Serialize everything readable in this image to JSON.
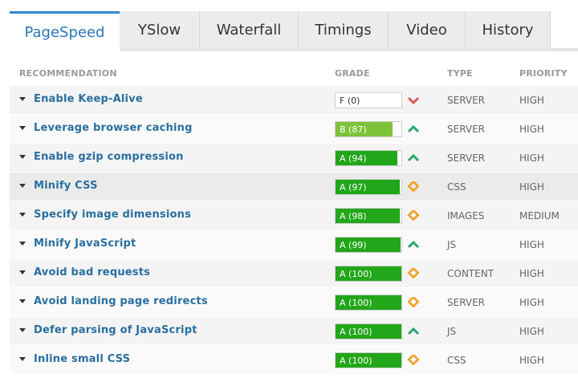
{
  "tabs": [
    {
      "label": "PageSpeed",
      "active": true
    },
    {
      "label": "YSlow",
      "active": false
    },
    {
      "label": "Waterfall",
      "active": false
    },
    {
      "label": "Timings",
      "active": false
    },
    {
      "label": "Video",
      "active": false
    },
    {
      "label": "History",
      "active": false
    }
  ],
  "columns": {
    "recommendation": "RECOMMENDATION",
    "grade": "GRADE",
    "type": "TYPE",
    "priority": "PRIORITY"
  },
  "colors": {
    "grade_a": "#22a61a",
    "grade_b": "#7ec23a",
    "trend_down": "#e05a5a",
    "trend_up": "#2aa86a",
    "trend_neutral": "#f0a020",
    "link": "#2a6f9f"
  },
  "rows": [
    {
      "name": "Enable Keep-Alive",
      "grade": "F (0)",
      "score": 0,
      "letter": "F",
      "trend": "down",
      "type": "SERVER",
      "priority": "HIGH"
    },
    {
      "name": "Leverage browser caching",
      "grade": "B (87)",
      "score": 87,
      "letter": "B",
      "trend": "up",
      "type": "SERVER",
      "priority": "HIGH"
    },
    {
      "name": "Enable gzip compression",
      "grade": "A (94)",
      "score": 94,
      "letter": "A",
      "trend": "up",
      "type": "SERVER",
      "priority": "HIGH"
    },
    {
      "name": "Minify CSS",
      "grade": "A (97)",
      "score": 97,
      "letter": "A",
      "trend": "neutral",
      "type": "CSS",
      "priority": "HIGH"
    },
    {
      "name": "Specify image dimensions",
      "grade": "A (98)",
      "score": 98,
      "letter": "A",
      "trend": "neutral",
      "type": "IMAGES",
      "priority": "MEDIUM"
    },
    {
      "name": "Minify JavaScript",
      "grade": "A (99)",
      "score": 99,
      "letter": "A",
      "trend": "up",
      "type": "JS",
      "priority": "HIGH"
    },
    {
      "name": "Avoid bad requests",
      "grade": "A (100)",
      "score": 100,
      "letter": "A",
      "trend": "neutral",
      "type": "CONTENT",
      "priority": "HIGH"
    },
    {
      "name": "Avoid landing page redirects",
      "grade": "A (100)",
      "score": 100,
      "letter": "A",
      "trend": "neutral",
      "type": "SERVER",
      "priority": "HIGH"
    },
    {
      "name": "Defer parsing of JavaScript",
      "grade": "A (100)",
      "score": 100,
      "letter": "A",
      "trend": "up",
      "type": "JS",
      "priority": "HIGH"
    },
    {
      "name": "Inline small CSS",
      "grade": "A (100)",
      "score": 100,
      "letter": "A",
      "trend": "neutral",
      "type": "CSS",
      "priority": "HIGH"
    }
  ]
}
